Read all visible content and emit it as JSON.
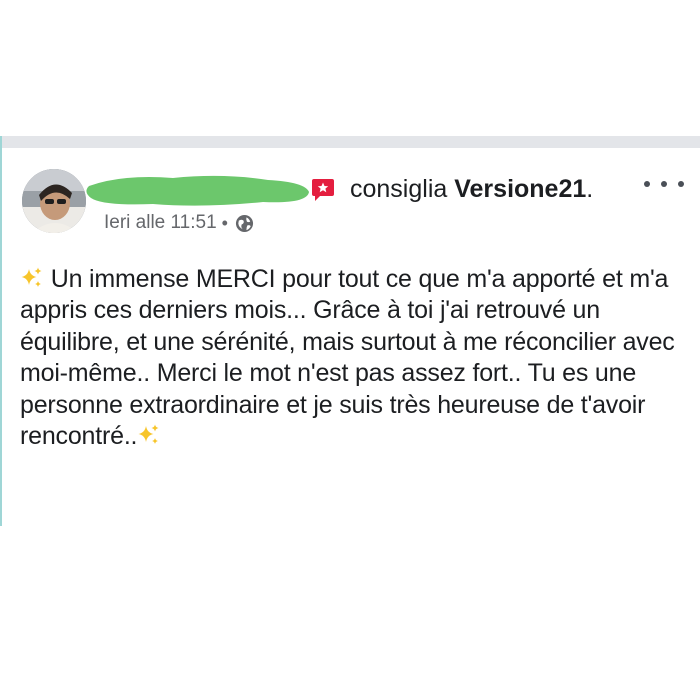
{
  "post": {
    "recommend_verb": "consiglia",
    "page_name": "Versione21",
    "page_suffix": ".",
    "timestamp": "Ieri alle 11:51",
    "separator": "•",
    "audience_icon": "globe-icon",
    "more_icon": "more-dots-icon",
    "recommend_icon": "recommend-star-icon",
    "text_before_sparkle": "Un immense MERCI pour tout ce que m'a apporté et m'a appris ces derniers mois... Grâce à toi j'ai retrouvé un équilibre, et une sérénité, mais surtout à me réconcilier avec moi-même.. Merci le mot n'est pas assez fort.. Tu es une personne extraordinaire et je suis très heureuse de t'avoir rencontré..",
    "emoji_icon": "sparkles-icon"
  },
  "colors": {
    "text": "#1c1e21",
    "meta_text": "#65676b",
    "recommend_badge": "#e41e3f",
    "redaction": "#6cc76c",
    "sparkle": "#f7c52b"
  }
}
